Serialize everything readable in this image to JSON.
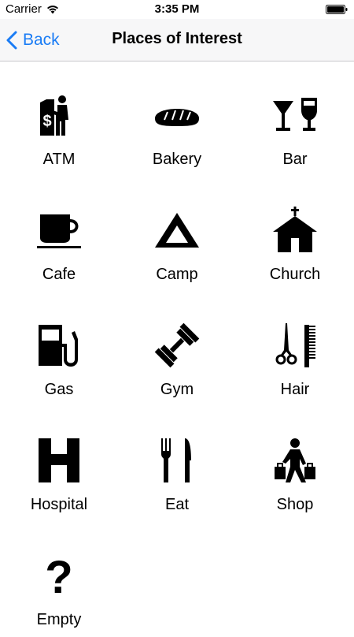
{
  "status_bar": {
    "carrier": "Carrier",
    "time": "3:35 PM"
  },
  "nav": {
    "back_label": "Back",
    "title": "Places of Interest"
  },
  "places": [
    {
      "label": "ATM",
      "icon": "atm-icon"
    },
    {
      "label": "Bakery",
      "icon": "bread-icon"
    },
    {
      "label": "Bar",
      "icon": "drinks-icon"
    },
    {
      "label": "Cafe",
      "icon": "coffee-cup-icon"
    },
    {
      "label": "Camp",
      "icon": "tent-icon"
    },
    {
      "label": "Church",
      "icon": "church-icon"
    },
    {
      "label": "Gas",
      "icon": "gas-pump-icon"
    },
    {
      "label": "Gym",
      "icon": "dumbbell-icon"
    },
    {
      "label": "Hair",
      "icon": "scissors-comb-icon"
    },
    {
      "label": "Hospital",
      "icon": "hospital-icon"
    },
    {
      "label": "Eat",
      "icon": "fork-knife-icon"
    },
    {
      "label": "Shop",
      "icon": "shopper-icon"
    },
    {
      "label": "Empty",
      "icon": "question-mark-icon"
    }
  ],
  "colors": {
    "accent": "#1a7cf5",
    "nav_background": "#f7f7f8",
    "icon": "#000000"
  }
}
